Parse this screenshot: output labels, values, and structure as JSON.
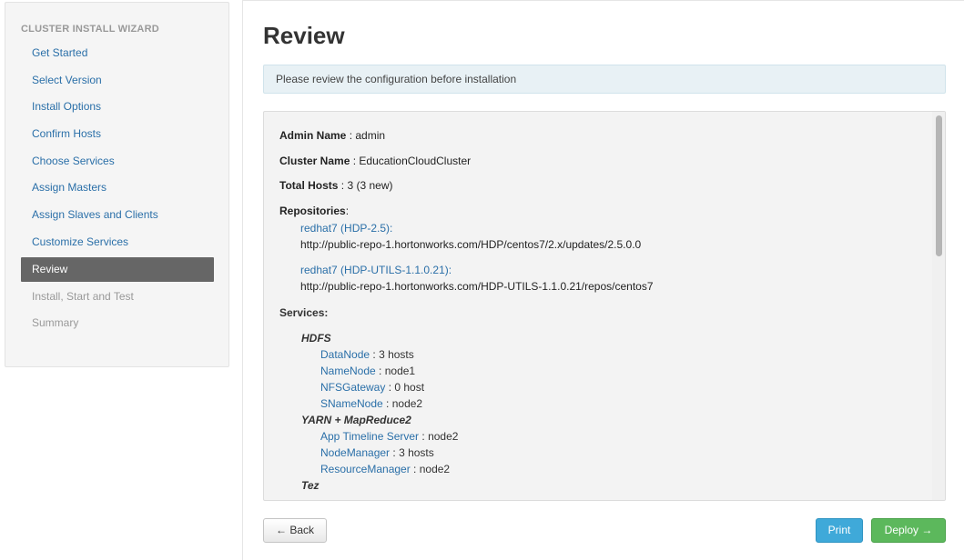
{
  "sidebar": {
    "title": "CLUSTER INSTALL WIZARD",
    "items": [
      {
        "label": "Get Started",
        "state": "link"
      },
      {
        "label": "Select Version",
        "state": "link"
      },
      {
        "label": "Install Options",
        "state": "link"
      },
      {
        "label": "Confirm Hosts",
        "state": "link"
      },
      {
        "label": "Choose Services",
        "state": "link"
      },
      {
        "label": "Assign Masters",
        "state": "link"
      },
      {
        "label": "Assign Slaves and Clients",
        "state": "link"
      },
      {
        "label": "Customize Services",
        "state": "link"
      },
      {
        "label": "Review",
        "state": "active"
      },
      {
        "label": "Install, Start and Test",
        "state": "disabled"
      },
      {
        "label": "Summary",
        "state": "disabled"
      }
    ]
  },
  "main": {
    "title": "Review",
    "alert": "Please review the configuration before installation",
    "admin": {
      "label": "Admin Name",
      "value": "admin"
    },
    "cluster": {
      "label": "Cluster Name",
      "value": "EducationCloudCluster"
    },
    "hosts": {
      "label": "Total Hosts",
      "value": "3 (3 new)"
    },
    "repositories_label": "Repositories",
    "repositories": [
      {
        "name": "redhat7 (HDP-2.5):",
        "url": "http://public-repo-1.hortonworks.com/HDP/centos7/2.x/updates/2.5.0.0"
      },
      {
        "name": "redhat7 (HDP-UTILS-1.1.0.21):",
        "url": "http://public-repo-1.hortonworks.com/HDP-UTILS-1.1.0.21/repos/centos7"
      }
    ],
    "services_label": "Services:",
    "services": {
      "hdfs": {
        "name": "HDFS",
        "components": [
          {
            "name": "DataNode",
            "value": "3 hosts"
          },
          {
            "name": "NameNode",
            "value": "node1"
          },
          {
            "name": "NFSGateway",
            "value": "0 host"
          },
          {
            "name": "SNameNode",
            "value": "node2"
          }
        ]
      },
      "yarn": {
        "name": "YARN + MapReduce2",
        "components": [
          {
            "name": "App Timeline Server",
            "value": "node2"
          },
          {
            "name": "NodeManager",
            "value": "3 hosts"
          },
          {
            "name": "ResourceManager",
            "value": "node2"
          }
        ]
      },
      "tez": {
        "name": "Tez"
      }
    }
  },
  "buttons": {
    "back": "← Back",
    "print": "Print",
    "deploy": "Deploy →"
  },
  "colors": {
    "link": "#2a6fa8",
    "active_nav": "#666666",
    "print_button": "#3fa9d9",
    "deploy_button": "#5cb85c"
  }
}
